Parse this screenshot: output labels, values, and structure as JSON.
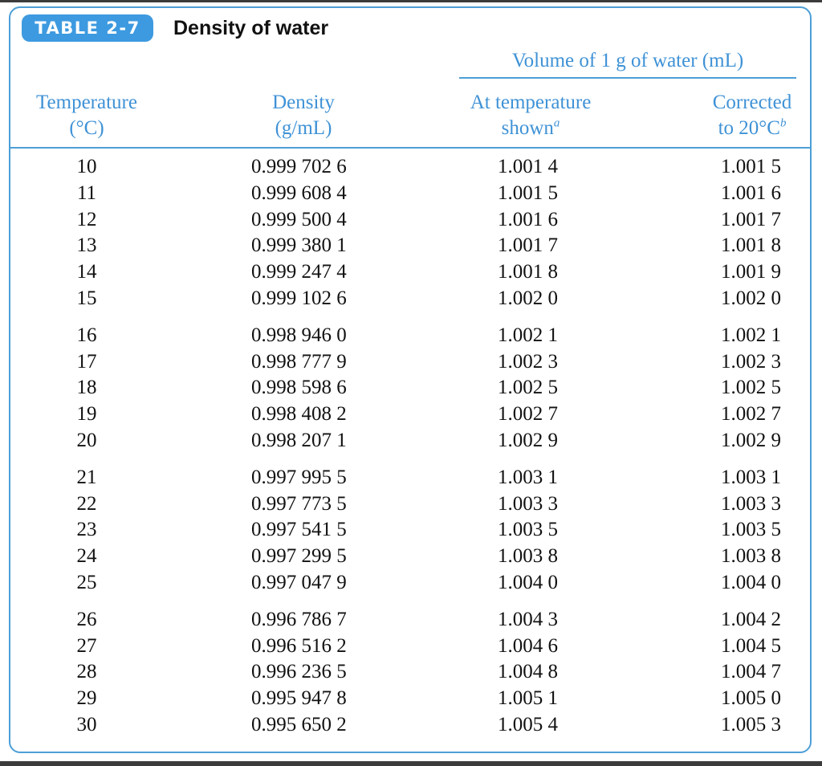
{
  "table": {
    "tag": "TABLE 2-7",
    "title": "Density of water",
    "group_header": "Volume of 1 g of water (mL)",
    "columns": {
      "temperature": {
        "line1": "Temperature",
        "line2": "(°C)"
      },
      "density": {
        "line1": "Density",
        "line2": "(g/mL)"
      },
      "at_temperature": {
        "line1": "At temperature",
        "line2": "shown",
        "footnote": "a"
      },
      "corrected": {
        "line1": "Corrected",
        "line2": "to 20°C",
        "footnote": "b"
      }
    },
    "row_groups": [
      [
        {
          "temperature": "10",
          "density": "0.999 702 6",
          "at_temperature": "1.001 4",
          "corrected": "1.001 5"
        },
        {
          "temperature": "11",
          "density": "0.999 608 4",
          "at_temperature": "1.001 5",
          "corrected": "1.001 6"
        },
        {
          "temperature": "12",
          "density": "0.999 500 4",
          "at_temperature": "1.001 6",
          "corrected": "1.001 7"
        },
        {
          "temperature": "13",
          "density": "0.999 380 1",
          "at_temperature": "1.001 7",
          "corrected": "1.001 8"
        },
        {
          "temperature": "14",
          "density": "0.999 247 4",
          "at_temperature": "1.001 8",
          "corrected": "1.001 9"
        },
        {
          "temperature": "15",
          "density": "0.999 102 6",
          "at_temperature": "1.002 0",
          "corrected": "1.002 0"
        }
      ],
      [
        {
          "temperature": "16",
          "density": "0.998 946 0",
          "at_temperature": "1.002 1",
          "corrected": "1.002 1"
        },
        {
          "temperature": "17",
          "density": "0.998 777 9",
          "at_temperature": "1.002 3",
          "corrected": "1.002 3"
        },
        {
          "temperature": "18",
          "density": "0.998 598 6",
          "at_temperature": "1.002 5",
          "corrected": "1.002 5"
        },
        {
          "temperature": "19",
          "density": "0.998 408 2",
          "at_temperature": "1.002 7",
          "corrected": "1.002 7"
        },
        {
          "temperature": "20",
          "density": "0.998 207 1",
          "at_temperature": "1.002 9",
          "corrected": "1.002 9"
        }
      ],
      [
        {
          "temperature": "21",
          "density": "0.997 995 5",
          "at_temperature": "1.003 1",
          "corrected": "1.003 1"
        },
        {
          "temperature": "22",
          "density": "0.997 773 5",
          "at_temperature": "1.003 3",
          "corrected": "1.003 3"
        },
        {
          "temperature": "23",
          "density": "0.997 541 5",
          "at_temperature": "1.003 5",
          "corrected": "1.003 5"
        },
        {
          "temperature": "24",
          "density": "0.997 299 5",
          "at_temperature": "1.003 8",
          "corrected": "1.003 8"
        },
        {
          "temperature": "25",
          "density": "0.997 047 9",
          "at_temperature": "1.004 0",
          "corrected": "1.004 0"
        }
      ],
      [
        {
          "temperature": "26",
          "density": "0.996 786 7",
          "at_temperature": "1.004 3",
          "corrected": "1.004 2"
        },
        {
          "temperature": "27",
          "density": "0.996 516 2",
          "at_temperature": "1.004 6",
          "corrected": "1.004 5"
        },
        {
          "temperature": "28",
          "density": "0.996 236 5",
          "at_temperature": "1.004 8",
          "corrected": "1.004 7"
        },
        {
          "temperature": "29",
          "density": "0.995 947 8",
          "at_temperature": "1.005 1",
          "corrected": "1.005 0"
        },
        {
          "temperature": "30",
          "density": "0.995 650 2",
          "at_temperature": "1.005 4",
          "corrected": "1.005 3"
        }
      ]
    ],
    "colors": {
      "accent": "#3d9ae0",
      "rule": "#4d9fd6",
      "header_text": "#3f92d6",
      "body_text": "#111111"
    }
  }
}
